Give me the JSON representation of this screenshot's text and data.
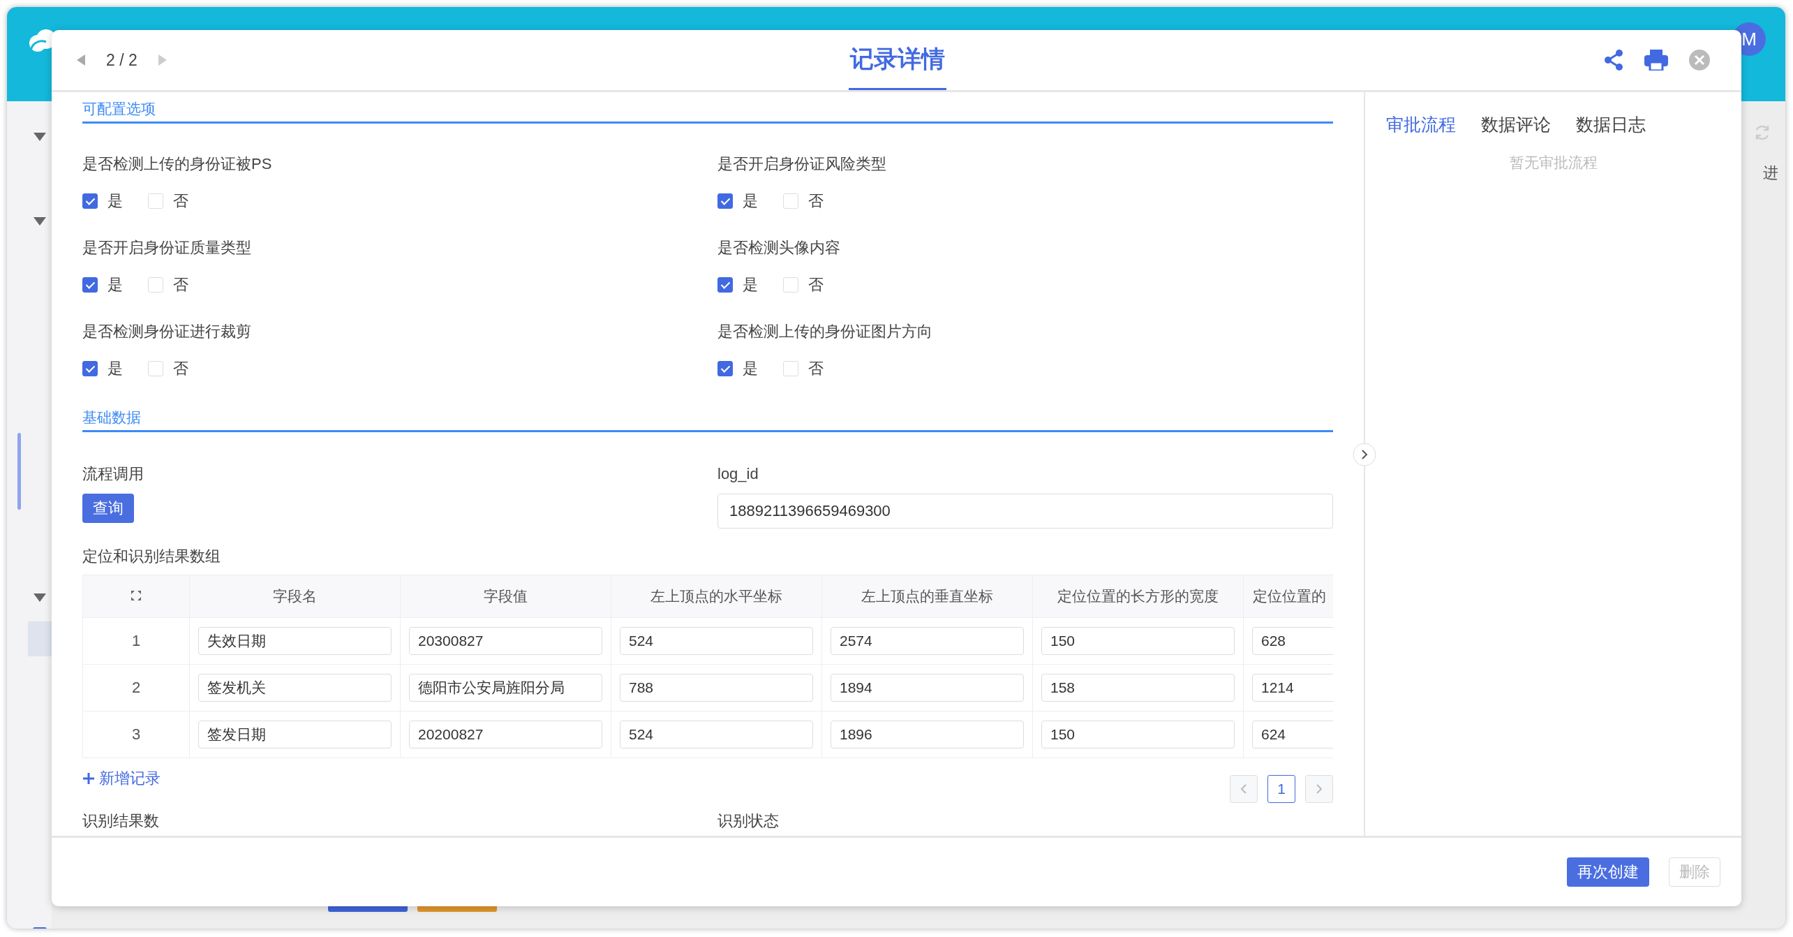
{
  "background": {
    "avatar": "M",
    "side_text": "进",
    "bottom_buttons": [
      {
        "color": "#3f63d6"
      },
      {
        "color": "#e0962a"
      }
    ]
  },
  "modal": {
    "pager": "2 / 2",
    "title": "记录详情"
  },
  "config_section": {
    "title": "可配置选项",
    "options": [
      {
        "label": "是否检测上传的身份证被PS",
        "choices": [
          {
            "label": "是",
            "checked": true
          },
          {
            "label": "否",
            "checked": false
          }
        ]
      },
      {
        "label": "是否开启身份证风险类型",
        "choices": [
          {
            "label": "是",
            "checked": true
          },
          {
            "label": "否",
            "checked": false
          }
        ]
      },
      {
        "label": "是否开启身份证质量类型",
        "choices": [
          {
            "label": "是",
            "checked": true
          },
          {
            "label": "否",
            "checked": false
          }
        ]
      },
      {
        "label": "是否检测头像内容",
        "choices": [
          {
            "label": "是",
            "checked": true
          },
          {
            "label": "否",
            "checked": false
          }
        ]
      },
      {
        "label": "是否检测身份证进行裁剪",
        "choices": [
          {
            "label": "是",
            "checked": true
          },
          {
            "label": "否",
            "checked": false
          }
        ]
      },
      {
        "label": "是否检测上传的身份证图片方向",
        "choices": [
          {
            "label": "是",
            "checked": true
          },
          {
            "label": "否",
            "checked": false
          }
        ]
      }
    ]
  },
  "basic_section": {
    "title": "基础数据",
    "process_call": {
      "label": "流程调用",
      "button": "查询"
    },
    "log_id": {
      "label": "log_id",
      "value": "1889211396659469300"
    },
    "result_array": {
      "label": "定位和识别结果数组",
      "columns": [
        "字段名",
        "字段值",
        "左上顶点的水平坐标",
        "左上顶点的垂直坐标",
        "定位位置的长方形的宽度",
        "定位位置的"
      ],
      "rows": [
        {
          "index": "1",
          "cells": [
            "失效日期",
            "20300827",
            "524",
            "2574",
            "150",
            "628"
          ]
        },
        {
          "index": "2",
          "cells": [
            "签发机关",
            "德阳市公安局旌阳分局",
            "788",
            "1894",
            "158",
            "1214"
          ]
        },
        {
          "index": "3",
          "cells": [
            "签发日期",
            "20200827",
            "524",
            "1896",
            "150",
            "624"
          ]
        }
      ],
      "add_link": "新增记录",
      "pages": [
        {
          "label": "1",
          "selected": true
        }
      ]
    },
    "more_fields": [
      "识别结果数",
      "识别状态"
    ]
  },
  "side_panel": {
    "tabs": [
      {
        "label": "审批流程",
        "selected": true
      },
      {
        "label": "数据评论",
        "selected": false
      },
      {
        "label": "数据日志",
        "selected": false
      }
    ],
    "empty_text": "暂无审批流程"
  },
  "footer": {
    "buttons": [
      {
        "label": "再次创建",
        "kind": "primary",
        "disabled": false
      },
      {
        "label": "删除",
        "kind": "default",
        "disabled": true
      }
    ]
  }
}
